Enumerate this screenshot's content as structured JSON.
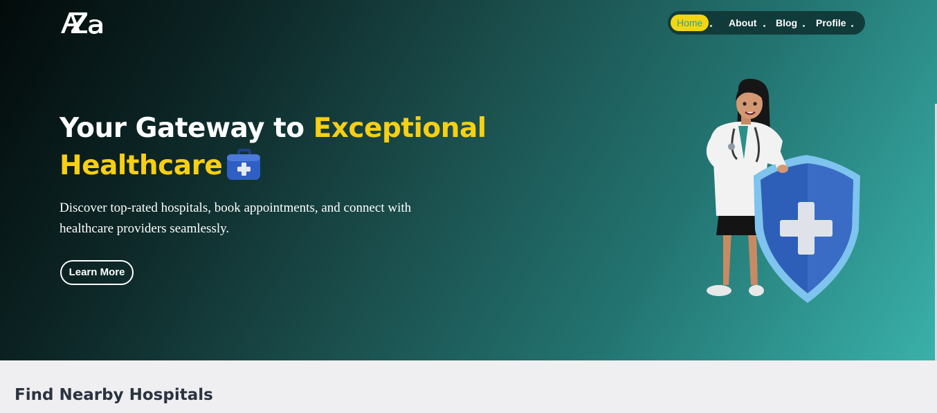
{
  "brand": {
    "logo_text": "AZa"
  },
  "nav": {
    "items": [
      {
        "label": "Home",
        "active": true
      },
      {
        "label": "About",
        "active": false
      },
      {
        "label": "Blog",
        "active": false
      },
      {
        "label": "Profile",
        "active": false
      }
    ]
  },
  "hero": {
    "title_part1": "Your Gateway to",
    "title_highlight_1": "Exceptional",
    "title_highlight_2": "Healthcare",
    "description": "Discover top-rated hospitals, book appointments, and connect with healthcare providers seamlessly.",
    "cta_label": "Learn More"
  },
  "section": {
    "title": "Find Nearby Hospitals"
  },
  "colors": {
    "accent_yellow": "#f7cf13",
    "teal": "#2aa19b",
    "nav_bg": "#113b3a",
    "section_bg": "#efeff1"
  },
  "icons": {
    "title_icon": "first-aid-kit-icon",
    "illustration": "doctor-with-shield-illustration"
  }
}
